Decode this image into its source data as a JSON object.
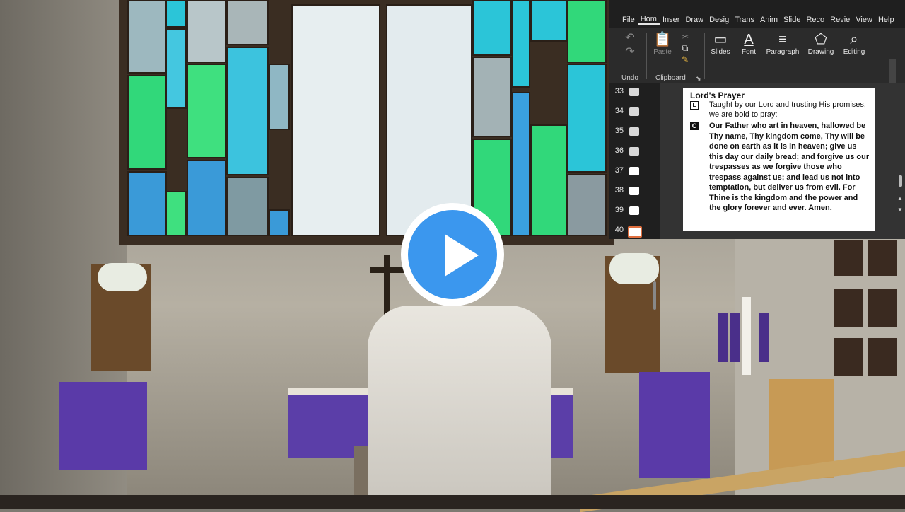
{
  "ppt": {
    "tabs": [
      "File",
      "Hom",
      "Inser",
      "Draw",
      "Desig",
      "Trans",
      "Anim",
      "Slide",
      "Reco",
      "Revie",
      "View",
      "Help"
    ],
    "groups": {
      "undo_label": "Undo",
      "clipboard_label": "Clipboard",
      "paste_label": "Paste",
      "slides_label": "Slides",
      "font_label": "Font",
      "paragraph_label": "Paragraph",
      "drawing_label": "Drawing",
      "editing_label": "Editing"
    },
    "slide_numbers": [
      "33",
      "34",
      "35",
      "36",
      "37",
      "38",
      "39",
      "40"
    ],
    "selected_slide": "40",
    "slide": {
      "title": "Lord's Prayer",
      "leader_mark": "L",
      "leader_text": "Taught by our Lord and trusting His promises, we are bold to pray:",
      "congregation_mark": "C",
      "congregation_text": "Our Father who art in heaven, hallowed be Thy name, Thy kingdom come, Thy will be done on earth as it is in heaven; give us this day our daily bread; and forgive us our trespasses as we forgive those who trespass against us; and lead us not into temptation, but deliver us from evil. For Thine is the kingdom and the power and the glory forever and ever. Amen."
    }
  },
  "video": {
    "play_icon": "play-icon",
    "accent": "#3b97ee"
  }
}
